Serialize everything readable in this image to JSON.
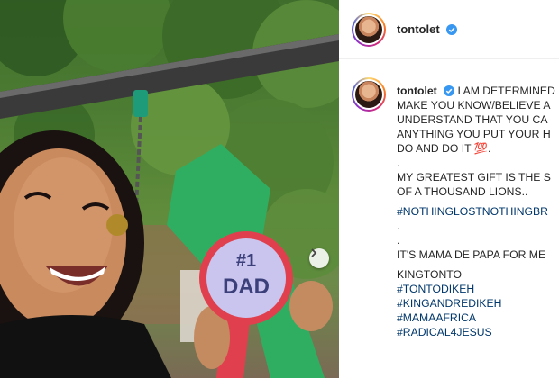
{
  "post": {
    "username": "tontolet",
    "verified": true
  },
  "photo": {
    "badge_number": "#1",
    "badge_text": "DAD"
  },
  "caption": {
    "line_1": "I AM DETERMINED",
    "line_2": "MAKE YOU KNOW/BELIEVE A",
    "line_3": "UNDERSTAND THAT YOU CA",
    "line_4": "ANYTHING YOU PUT YOUR H",
    "line_5": "DO AND DO IT",
    "emoji_100": "💯",
    "line_5b": ".",
    "dot_1": ".",
    "line_6": "MY GREATEST GIFT IS THE S",
    "line_7": "OF A THOUSAND LIONS..",
    "hashtag_1": "#NOTHINGLOSTNOTHINGBR",
    "dot_2": ".",
    "dot_3": ".",
    "line_8": "IT'S MAMA DE PAPA FOR ME",
    "line_9": "KINGTONTO",
    "hashtag_2": "#TONTODIKEH",
    "hashtag_3": "#KINGANDREDIKEH",
    "hashtag_4": "#MAMAAFRICA",
    "hashtag_5": "#RADICAL4JESUS"
  },
  "colors": {
    "link": "#00376b",
    "verified_blue": "#3897f0",
    "ribbon_green": "#2fae62",
    "ribbon_red": "#e0404e",
    "badge_lilac": "#c9c5ee"
  },
  "icons": {
    "verified": "verified-badge-icon",
    "next": "chevron-right-icon"
  }
}
